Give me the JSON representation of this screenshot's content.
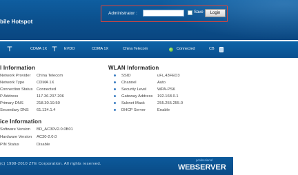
{
  "header": {
    "brand": "bile Hotspot",
    "login": {
      "label": "Administrator :",
      "password_value": "",
      "save_label": "Save",
      "button_label": "Login"
    }
  },
  "statusbar": {
    "items": [
      "CDMA 1X",
      "EVDO",
      "CDMA 1X",
      "China Telecom",
      "Connected",
      "CB"
    ]
  },
  "device_info": {
    "title": "l Information",
    "rows": [
      {
        "label": "Network Provider",
        "value": "China Telecom"
      },
      {
        "label": "Network Type",
        "value": "CDMA 1X"
      },
      {
        "label": "Connection Status",
        "value": "Connected"
      },
      {
        "label": "P Address",
        "value": "117.36.207.206"
      },
      {
        "label": "Primary DNS",
        "value": "218.30.19.50"
      },
      {
        "label": "Secondary DNS",
        "value": "61.134.1.4"
      }
    ]
  },
  "wlan_info": {
    "title": "WLAN Information",
    "rows": [
      {
        "label": "SSID",
        "value": "uFi_43FED3"
      },
      {
        "label": "Channel",
        "value": "Auto"
      },
      {
        "label": "Security Level",
        "value": "WPA-PSK"
      },
      {
        "label": "Gateway Address",
        "value": "192.168.0.1"
      },
      {
        "label": "Subnet Mask",
        "value": "255.255.255.0"
      },
      {
        "label": "DHCP Server",
        "value": "Enable"
      }
    ]
  },
  "software_info": {
    "title": "ice Information",
    "rows": [
      {
        "label": "Software Version",
        "value": "BD_AC30V2.0.0B01"
      },
      {
        "label": "Hardware Version",
        "value": "AC30-2.0.0"
      },
      {
        "label": "PIN Status",
        "value": "Disable"
      }
    ]
  },
  "footer": {
    "copyright": "(c) 1998-2010 ZTE Corporation. All rights reserved.",
    "logo_pro": "professional",
    "logo_web": "WEB",
    "logo_server": "SERVER"
  },
  "colors": {
    "header_blue": "#0b4f8c",
    "status_green": "#3fa020",
    "login_highlight": "#e0443a"
  }
}
